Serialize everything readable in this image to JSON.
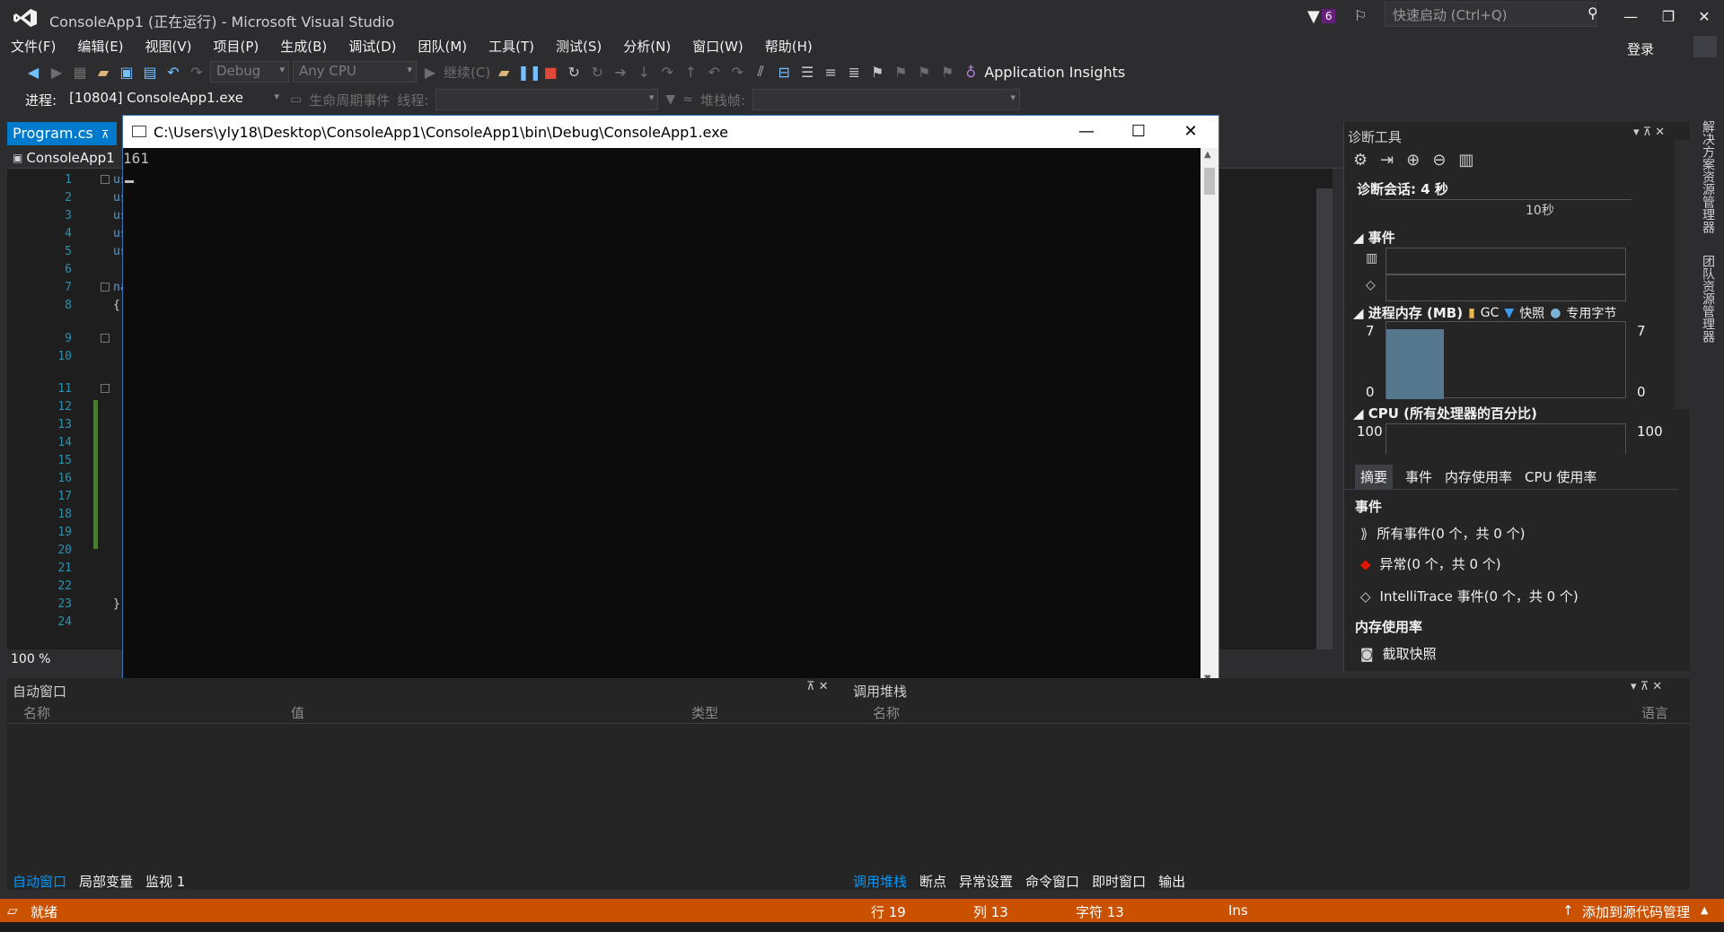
{
  "window": {
    "title": "ConsoleApp1 (正在运行) - Microsoft Visual Studio",
    "notif_count": "6",
    "quick_launch_placeholder": "快速启动 (Ctrl+Q)",
    "login": "登录"
  },
  "menu": [
    "文件(F)",
    "编辑(E)",
    "视图(V)",
    "项目(P)",
    "生成(B)",
    "调试(D)",
    "团队(M)",
    "工具(T)",
    "测试(S)",
    "分析(N)",
    "窗口(W)",
    "帮助(H)"
  ],
  "toolbar": {
    "config": "Debug",
    "platform": "Any CPU",
    "continue": "继续(C)",
    "app_insights": "Application Insights"
  },
  "procbar": {
    "process_label": "进程:",
    "process_value": "[10804] ConsoleApp1.exe",
    "lifecycle": "生命周期事件",
    "thread_label": "线程:",
    "stack_label": "堆栈帧:"
  },
  "editor": {
    "tab": "Program.cs",
    "nav_project": "ConsoleApp1",
    "lines": [
      "1",
      "2",
      "3",
      "4",
      "5",
      "6",
      "7",
      "8",
      "9",
      "10",
      "11",
      "12",
      "13",
      "14",
      "15",
      "16",
      "17",
      "18",
      "19",
      "20",
      "21",
      "22",
      "23",
      "24"
    ],
    "frag_us": "us",
    "frag_na": "na",
    "frag_open": "{",
    "frag_close": "}",
    "zoom": "100 %"
  },
  "console": {
    "path": "C:\\Users\\yly18\\Desktop\\ConsoleApp1\\ConsoleApp1\\bin\\Debug\\ConsoleApp1.exe",
    "output": "161"
  },
  "diag": {
    "title": "诊断工具",
    "session": "诊断会话: 4 秒",
    "timeline_label": "10秒",
    "events_title": "事件",
    "memory_title": "进程内存 (MB)",
    "legend_gc": "GC",
    "legend_snapshot": "快照",
    "legend_private": "专用字节",
    "mem_max": "7",
    "mem_min": "0",
    "cpu_title": "CPU (所有处理器的百分比)",
    "cpu_max": "100",
    "tabs": [
      "摘要",
      "事件",
      "内存使用率",
      "CPU 使用率"
    ],
    "summary_events_title": "事件",
    "all_events": "所有事件(0 个，共 0 个)",
    "exceptions": "异常(0 个，共 0 个)",
    "intellitrace": "IntelliTrace 事件(0 个，共 0 个)",
    "mem_usage_title": "内存使用率",
    "take_snapshot": "截取快照"
  },
  "side_tabs": [
    "解决方案资源管理器",
    "团队资源管理器"
  ],
  "autos": {
    "title": "自动窗口",
    "col_name": "名称",
    "col_value": "值",
    "col_type": "类型",
    "tabs": [
      "自动窗口",
      "局部变量",
      "监视 1"
    ]
  },
  "callstack": {
    "title": "调用堆栈",
    "col_name": "名称",
    "col_lang": "语言",
    "tabs": [
      "调用堆栈",
      "断点",
      "异常设置",
      "命令窗口",
      "即时窗口",
      "输出"
    ]
  },
  "status": {
    "ready": "就绪",
    "line": "行 19",
    "col": "列 13",
    "char": "字符 13",
    "ins": "Ins",
    "source_control": "添加到源代码管理"
  },
  "colors": {
    "status_orange": "#ca5100",
    "accent_blue": "#007acc",
    "mem_bar": "#55788f"
  }
}
